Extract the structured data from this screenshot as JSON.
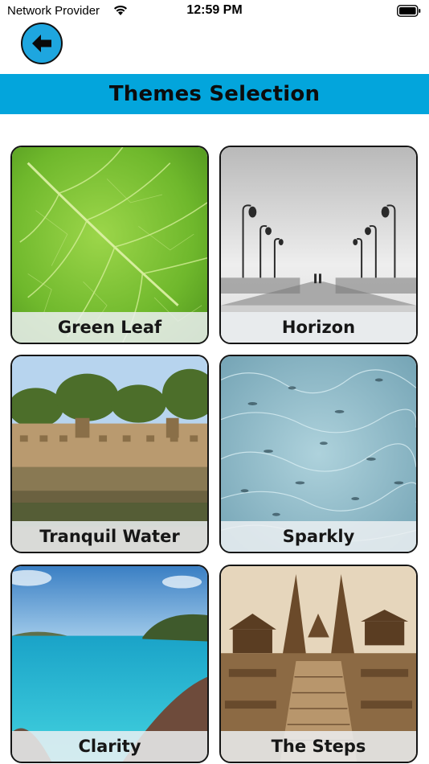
{
  "status_bar": {
    "carrier": "Network Provider",
    "time": "12:59 PM",
    "wifi_icon": "wifi-icon",
    "battery_icon": "battery-icon"
  },
  "back_button": {
    "icon": "arrow-left-icon",
    "color": "#1ea6df"
  },
  "header": {
    "title": "Themes Selection",
    "background": "#03a5dc"
  },
  "themes": [
    {
      "label": "Green Leaf"
    },
    {
      "label": "Horizon"
    },
    {
      "label": "Tranquil Water"
    },
    {
      "label": "Sparkly"
    },
    {
      "label": "Clarity"
    },
    {
      "label": "The Steps"
    }
  ]
}
